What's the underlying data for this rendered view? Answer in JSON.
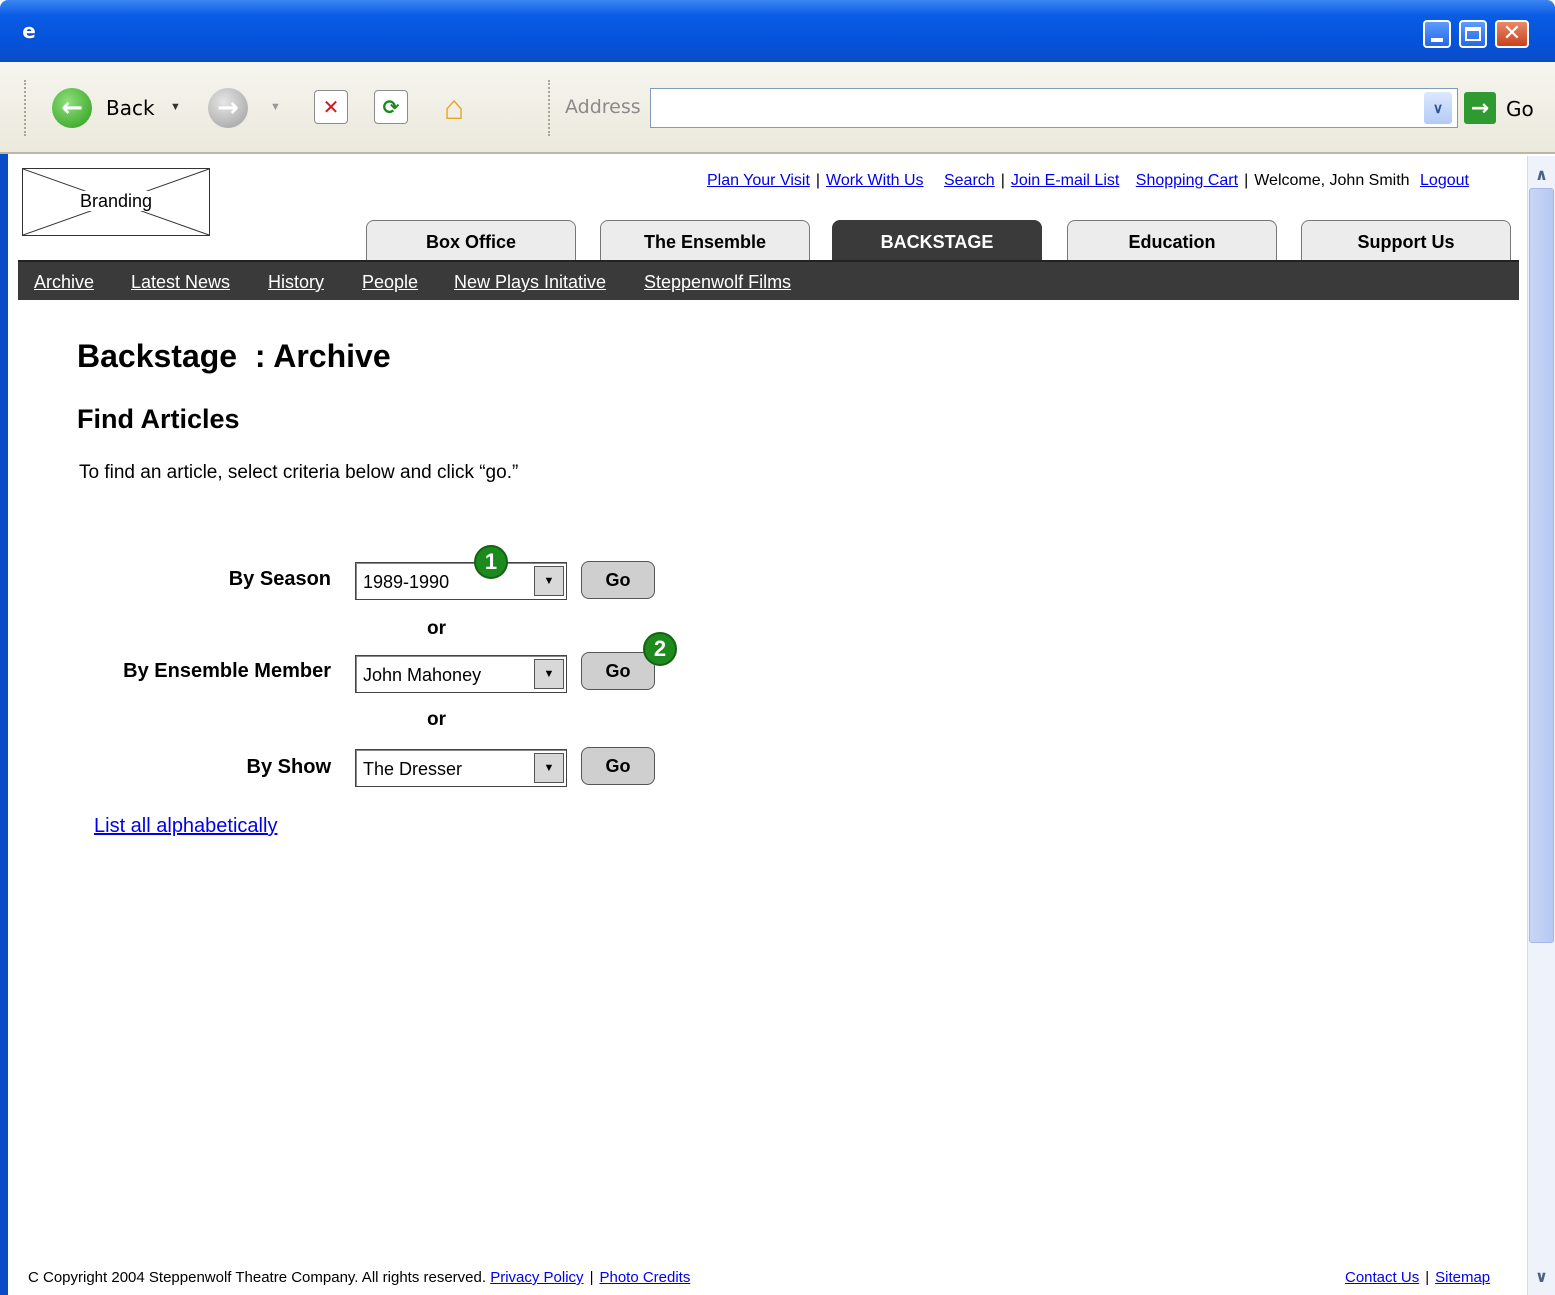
{
  "browser": {
    "toolbar": {
      "back_label": "Back",
      "address_label": "Address",
      "address_value": "",
      "go_label": "Go"
    }
  },
  "site": {
    "branding_label": "Branding",
    "utility_nav": {
      "plan_visit": "Plan Your Visit",
      "work_with_us": "Work With Us",
      "search": "Search",
      "join_email": "Join E-mail List",
      "shopping_cart": "Shopping Cart",
      "welcome": "Welcome, John Smith",
      "logout": "Logout",
      "separator": "|"
    },
    "tabs": [
      {
        "label": "Box Office"
      },
      {
        "label": "The Ensemble"
      },
      {
        "label": "BACKSTAGE",
        "active": true
      },
      {
        "label": "Education"
      },
      {
        "label": "Support Us"
      }
    ],
    "subnav": [
      {
        "label": "Archive"
      },
      {
        "label": "Latest News"
      },
      {
        "label": "History"
      },
      {
        "label": "People"
      },
      {
        "label": "New Plays Initative"
      },
      {
        "label": "Steppenwolf Films"
      }
    ]
  },
  "main": {
    "page_title": "Backstage  : Archive",
    "section_title": "Find Articles",
    "instructions": "To find an article, select criteria below and click “go.”",
    "form": {
      "season": {
        "label": "By Season",
        "value": "1989-1990",
        "go": "Go"
      },
      "or_text": "or",
      "member": {
        "label": "By Ensemble Member",
        "value": "John Mahoney",
        "go": "Go"
      },
      "show": {
        "label": "By Show",
        "value": "The Dresser",
        "go": "Go"
      }
    },
    "markers": [
      "1",
      "2"
    ],
    "list_all": "List all alphabetically"
  },
  "footer": {
    "copyright": "C Copyright 2004 Steppenwolf Theatre Company. All rights reserved.",
    "privacy": "Privacy Policy",
    "photo_credits": "Photo Credits",
    "contact": "Contact Us",
    "sitemap": "Sitemap",
    "separator": "|"
  }
}
